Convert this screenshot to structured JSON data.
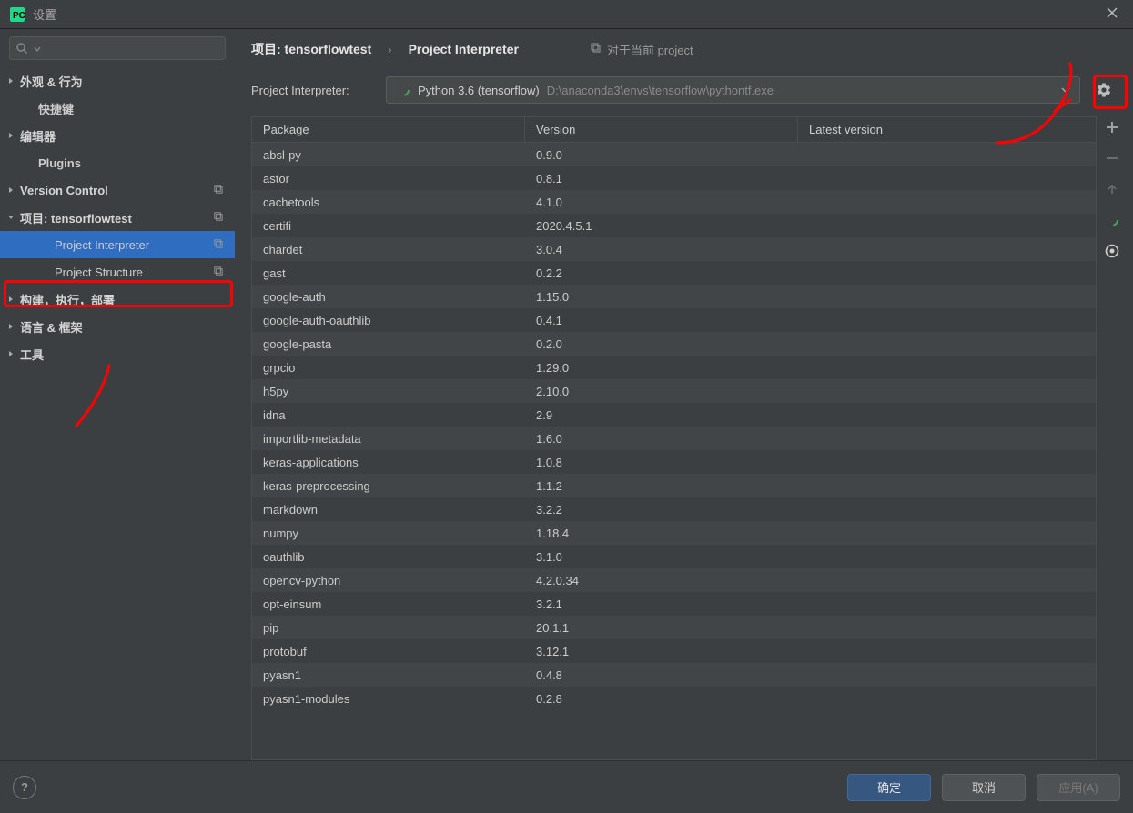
{
  "window": {
    "title": "设置"
  },
  "search_placeholder": "",
  "sidebar": {
    "items": [
      {
        "label": "外观 & 行为",
        "kind": "parent"
      },
      {
        "label": "快捷键",
        "kind": "child"
      },
      {
        "label": "编辑器",
        "kind": "parent"
      },
      {
        "label": "Plugins",
        "kind": "child"
      },
      {
        "label": "Version Control",
        "kind": "parent",
        "copy": true
      },
      {
        "label": "项目: tensorflowtest",
        "kind": "parent",
        "expanded": true,
        "copy": true
      },
      {
        "label": "Project Interpreter",
        "kind": "child2",
        "selected": true,
        "copy": true
      },
      {
        "label": "Project Structure",
        "kind": "child2",
        "copy": true
      },
      {
        "label": "构建，执行，部署",
        "kind": "parent"
      },
      {
        "label": "语言 & 框架",
        "kind": "parent"
      },
      {
        "label": "工具",
        "kind": "parent"
      }
    ]
  },
  "breadcrumb": {
    "left": "项目: tensorflowtest",
    "right": "Project Interpreter",
    "hint": "对于当前 project"
  },
  "interpreter": {
    "label": "Project Interpreter:",
    "value": "Python 3.6 (tensorflow)",
    "path": "D:\\anaconda3\\envs\\tensorflow\\pythontf.exe"
  },
  "table": {
    "headers": {
      "package": "Package",
      "version": "Version",
      "latest": "Latest version"
    },
    "rows": [
      {
        "name": "absl-py",
        "version": "0.9.0"
      },
      {
        "name": "astor",
        "version": "0.8.1"
      },
      {
        "name": "cachetools",
        "version": "4.1.0"
      },
      {
        "name": "certifi",
        "version": "2020.4.5.1"
      },
      {
        "name": "chardet",
        "version": "3.0.4"
      },
      {
        "name": "gast",
        "version": "0.2.2"
      },
      {
        "name": "google-auth",
        "version": "1.15.0"
      },
      {
        "name": "google-auth-oauthlib",
        "version": "0.4.1"
      },
      {
        "name": "google-pasta",
        "version": "0.2.0"
      },
      {
        "name": "grpcio",
        "version": "1.29.0"
      },
      {
        "name": "h5py",
        "version": "2.10.0"
      },
      {
        "name": "idna",
        "version": "2.9"
      },
      {
        "name": "importlib-metadata",
        "version": "1.6.0"
      },
      {
        "name": "keras-applications",
        "version": "1.0.8"
      },
      {
        "name": "keras-preprocessing",
        "version": "1.1.2"
      },
      {
        "name": "markdown",
        "version": "3.2.2"
      },
      {
        "name": "numpy",
        "version": "1.18.4"
      },
      {
        "name": "oauthlib",
        "version": "3.1.0"
      },
      {
        "name": "opencv-python",
        "version": "4.2.0.34"
      },
      {
        "name": "opt-einsum",
        "version": "3.2.1"
      },
      {
        "name": "pip",
        "version": "20.1.1"
      },
      {
        "name": "protobuf",
        "version": "3.12.1"
      },
      {
        "name": "pyasn1",
        "version": "0.4.8"
      },
      {
        "name": "pyasn1-modules",
        "version": "0.2.8"
      }
    ]
  },
  "footer": {
    "ok": "确定",
    "cancel": "取消",
    "apply": "应用(A)"
  }
}
